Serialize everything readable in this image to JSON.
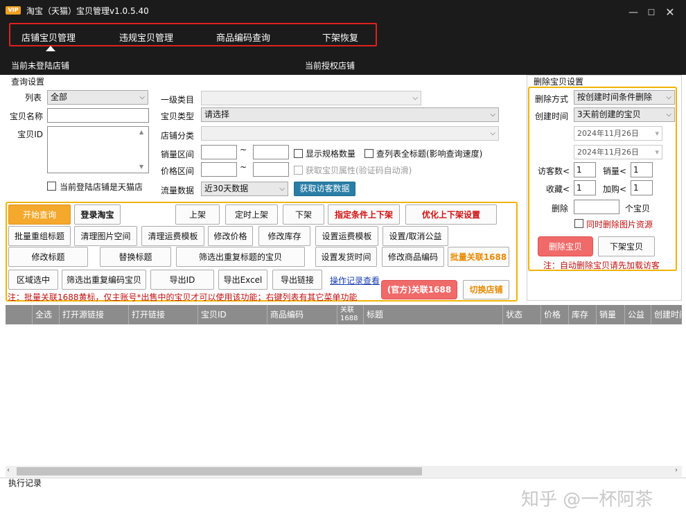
{
  "titlebar": {
    "vip": "VIP",
    "title": "淘宝（天猫）宝贝管理v1.0.5.40"
  },
  "nav": {
    "tabs": [
      "店铺宝贝管理",
      "违规宝贝管理",
      "商品编码查询",
      "下架恢复"
    ],
    "active": 0
  },
  "status": {
    "login": "当前未登陆店铺",
    "auth": "当前授权店铺"
  },
  "query": {
    "group_title": "查询设置",
    "list_label": "列表",
    "list_value": "全部",
    "name_label": "宝贝名称",
    "id_label": "宝贝ID",
    "tmall_check": "当前登陆店铺是天猫店",
    "cat_label": "一级类目",
    "type_label": "宝贝类型",
    "type_value": "请选择",
    "shopcat_label": "店铺分类",
    "sales_label": "销量区间",
    "price_label": "价格区间",
    "tilde": "~",
    "spec_check": "显示规格数量",
    "fulltitle_check": "查列表全标题(影响查询速度)",
    "attr_check": "获取宝贝属性(验证码自动滑)",
    "traffic_label": "流量数据",
    "traffic_value": "近30天数据",
    "visitor_btn": "获取访客数据"
  },
  "actions": {
    "row1": [
      "开始查询",
      "登录淘宝",
      "上架",
      "定时上架",
      "下架",
      "指定条件上下架",
      "优化上下架设置"
    ],
    "row2": [
      "批量重组标题",
      "清理图片空间",
      "清理运费模板",
      "修改价格",
      "修改库存",
      "设置运费模板",
      "设置/取消公益"
    ],
    "row3": [
      "修改标题",
      "替换标题",
      "筛选出重复标题的宝贝",
      "设置发货时间",
      "修改商品编码",
      "批量关联1688"
    ],
    "row4": [
      "区域选中",
      "筛选出重复编码宝贝",
      "导出ID",
      "导出Excel",
      "导出链接"
    ],
    "log_link": "操作记录查看",
    "official_btn": "(官方)关联1688",
    "switch_btn": "切换店铺",
    "note": "注：批量关联1688黄标，仅主账号*出售中的宝贝才可以使用该功能；右键列表有其它菜单功能"
  },
  "delete": {
    "group_title": "删除宝贝设置",
    "method_label": "删除方式",
    "method_value": "按创建时间条件删除",
    "time_label": "创建时间",
    "time_value": "3天前创建的宝贝",
    "date1": "2024年11月26日",
    "date2": "2024年11月26日",
    "visits_label": "访客数<",
    "visits_value": "1",
    "sales_label": "销量<",
    "sales_value": "1",
    "fav_label": "收藏<",
    "fav_value": "1",
    "cart_label": "加购<",
    "cart_value": "1",
    "del_label": "删除",
    "del_unit": "个宝贝",
    "img_check": "同时删除图片资源",
    "del_btn": "删除宝贝",
    "off_btn": "下架宝贝",
    "note": "注：自动删除宝贝请先加载访客"
  },
  "table": {
    "columns": [
      "全选",
      "打开源链接",
      "打开链接",
      "宝贝ID",
      "商品编码",
      "关联1688",
      "标题",
      "状态",
      "价格",
      "库存",
      "销量",
      "公益",
      "创建时间"
    ]
  },
  "log": {
    "title": "执行记录"
  },
  "watermark": "知乎 @一杯阿茶",
  "colors": {
    "accent_red": "#e02020",
    "accent_yellow": "#f0b400",
    "header_gray": "#8c8c8c"
  }
}
